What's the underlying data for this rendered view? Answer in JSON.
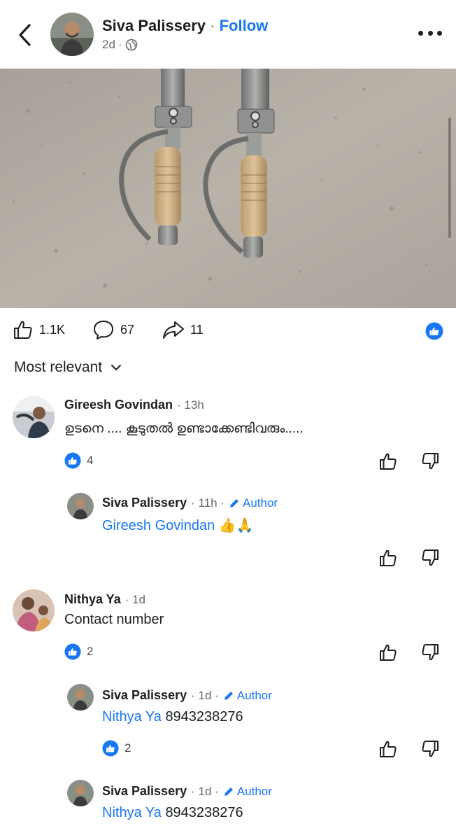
{
  "header": {
    "author": "Siva Palissery",
    "separator": "·",
    "follow_label": "Follow",
    "age": "2d",
    "meta_separator": "·",
    "privacy_icon": "globe-icon"
  },
  "post": {
    "likes": "1.1K",
    "comments": "67",
    "shares": "11"
  },
  "sort_label": "Most relevant",
  "comments": [
    {
      "name": "Gireesh Govindan",
      "time": "· 13h",
      "text": "ഉടനെ .... കൂടുതൽ ഉണ്ടാക്കേണ്ടിവരും.....",
      "likes": "4"
    },
    {
      "name": "Siva Palissery",
      "time": "· 11h ·",
      "author_label": "Author",
      "mention": "Gireesh Govindan",
      "text": "👍🙏"
    },
    {
      "name": "Nithya Ya",
      "time": "· 1d",
      "text": "Contact number",
      "likes": "2"
    },
    {
      "name": "Siva Palissery",
      "time": "· 1d ·",
      "author_label": "Author",
      "mention": "Nithya Ya",
      "text": "8943238276",
      "likes": "2"
    },
    {
      "name": "Siva Palissery",
      "time": "· 1d ·",
      "author_label": "Author",
      "mention": "Nithya Ya",
      "text": "8943238276"
    }
  ],
  "colors": {
    "brand_blue": "#1877f2",
    "meta_gray": "#65676b"
  }
}
